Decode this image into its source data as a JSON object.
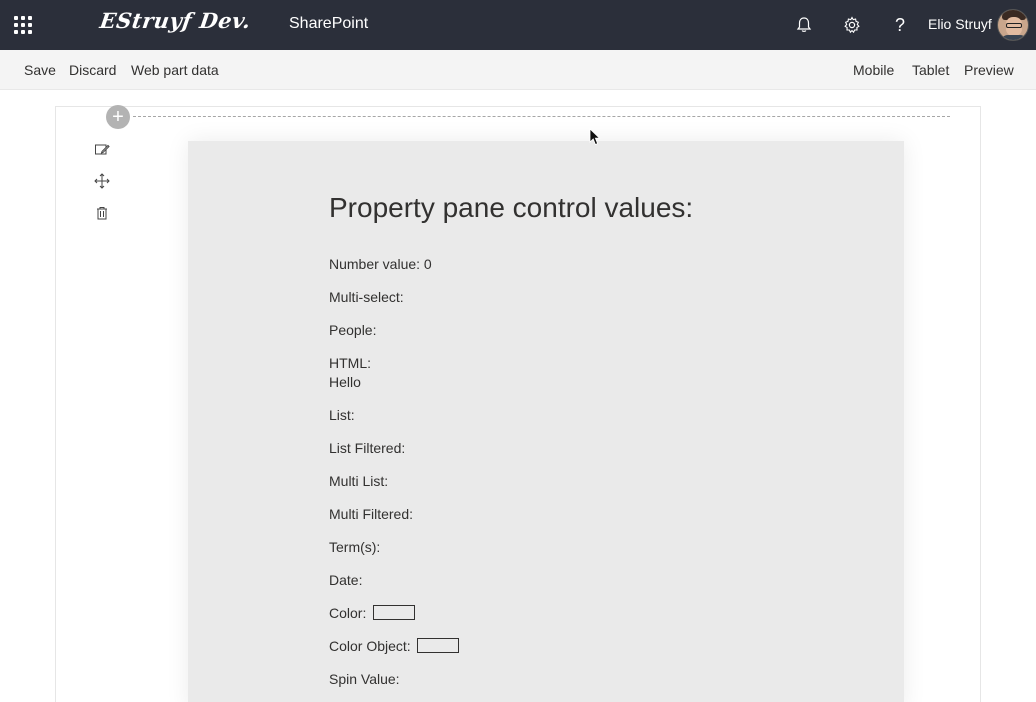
{
  "suite_bar": {
    "brand": "EStruyf Dev.",
    "app_name": "SharePoint",
    "user_name": "Elio Struyf",
    "help_glyph": "?"
  },
  "command_bar": {
    "left": [
      "Save",
      "Discard",
      "Web part data"
    ],
    "right": [
      "Mobile",
      "Tablet",
      "Preview"
    ]
  },
  "canvas": {
    "add_glyph": "+"
  },
  "webpart": {
    "title": "Property pane control values:",
    "lines": [
      "Number value: 0",
      "Multi-select:",
      "People:",
      "HTML:",
      "Hello",
      "List:",
      "List Filtered:",
      "Multi List:",
      "Multi Filtered:",
      "Term(s):",
      "Date:",
      "Color:",
      "Color Object:",
      "Spin Value:"
    ]
  },
  "icons": {
    "waffle": "waffle-icon",
    "bell": "bell-icon",
    "gear": "gear-icon",
    "help": "help-icon",
    "edit": "edit-icon",
    "move": "move-icon",
    "delete": "delete-icon",
    "add": "add-section-icon"
  },
  "colors": {
    "suite_bar": "#2b2f3a",
    "command_bar": "#f4f4f4",
    "webpart_bg": "#eaeaea"
  }
}
